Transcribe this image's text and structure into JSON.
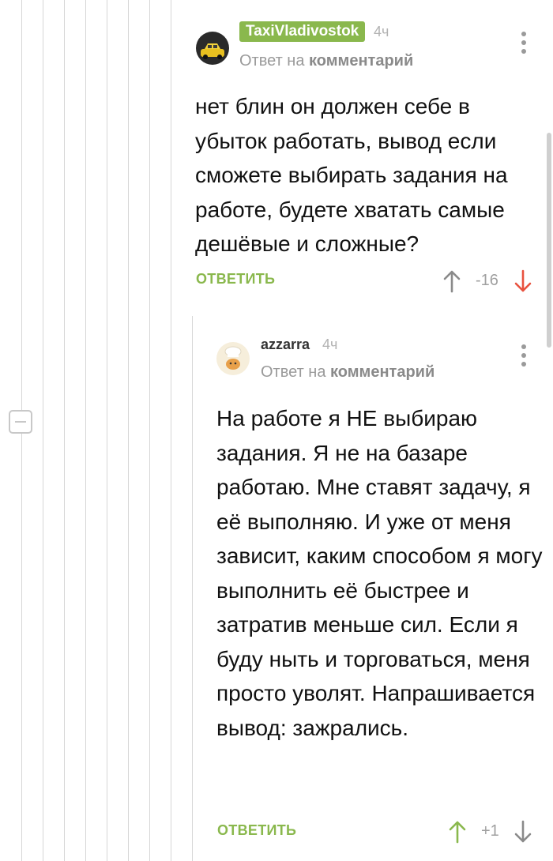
{
  "comment_1": {
    "username": "TaxiVladivostok",
    "time": "4ч",
    "reply_to_prefix": "Ответ на",
    "reply_to_target": "комментарий",
    "text": "нет блин он должен себе в убыток работать, вывод если сможете выбирать задания на работе, будете хватать самые дешёвые и сложные?",
    "reply_label": "ОТВЕТИТЬ",
    "score": "-16",
    "avatar_icon": "taxi-car-avatar"
  },
  "comment_2": {
    "username": "azzarra",
    "time": "4ч",
    "reply_to_prefix": "Ответ на",
    "reply_to_target": "комментарий",
    "text": "На работе я НЕ выбираю задания. Я не на базаре работаю. Мне ставят задачу, я её выполняю. И уже от меня зависит, каким способом я могу выполнить её быстрее и затратив меньше сил. Если я буду ныть и торговаться, меня просто уволят. Напрашивается вывод: зажрались.",
    "reply_label": "ОТВЕТИТЬ",
    "score": "+1",
    "avatar_icon": "cat-chef-avatar"
  },
  "colors": {
    "accent_green": "#8ab84d",
    "downvote_red": "#e8523f",
    "muted_gray": "#9a9a9a",
    "thread_line": "#d6d6d6"
  }
}
